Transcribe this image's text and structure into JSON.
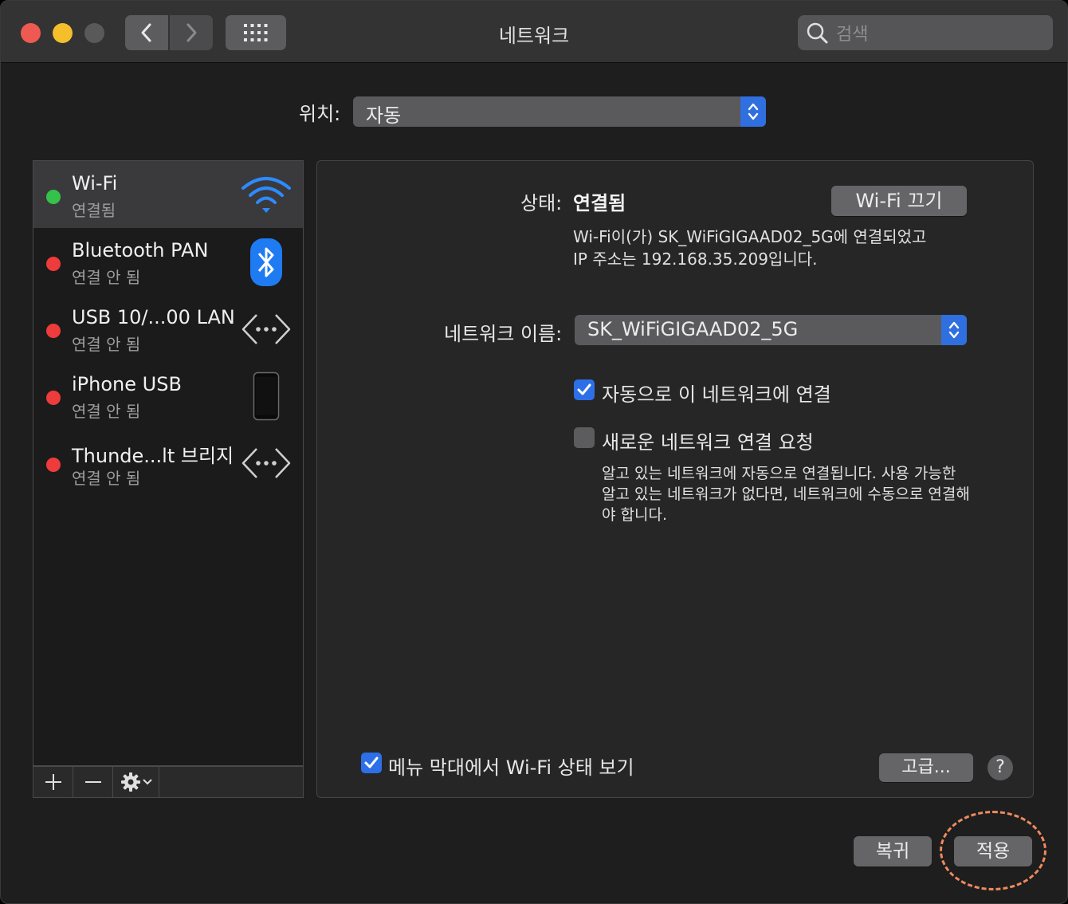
{
  "window": {
    "title": "네트워크"
  },
  "toolbar": {
    "search_placeholder": "검색"
  },
  "location": {
    "label": "위치:",
    "value": "자동"
  },
  "services": [
    {
      "name": "Wi-Fi",
      "status": "연결됨",
      "status_color": "#34c24a",
      "icon": "wifi-icon",
      "selected": true
    },
    {
      "name": "Bluetooth PAN",
      "status": "연결 안 됨",
      "status_color": "#ee3b3b",
      "icon": "bluetooth-icon"
    },
    {
      "name": "USB 10/...00 LAN",
      "status": "연결 안 됨",
      "status_color": "#ee3b3b",
      "icon": "ethernet-icon"
    },
    {
      "name": "iPhone USB",
      "status": "연결 안 됨",
      "status_color": "#ee3b3b",
      "icon": "iphone-icon"
    },
    {
      "name": "Thunde...lt 브리지",
      "status": "연결 안 됨",
      "status_color": "#ee3b3b",
      "icon": "ethernet-icon"
    }
  ],
  "detail": {
    "status_label": "상태:",
    "status_value": "연결됨",
    "wifi_off_button": "Wi-Fi 끄기",
    "status_desc_1": "Wi-Fi이(가) SK_WiFiGIGAAD02_5G에 연결되었고",
    "status_desc_2": "IP 주소는 192.168.35.209입니다.",
    "network_name_label": "네트워크 이름:",
    "network_name_value": "SK_WiFiGIGAAD02_5G",
    "auto_join_label": "자동으로 이 네트워크에 연결",
    "auto_join_checked": true,
    "ask_join_label": "새로운 네트워크 연결 요청",
    "ask_join_checked": false,
    "ask_desc_1": "알고 있는 네트워크에 자동으로 연결됩니다. 사용 가능한",
    "ask_desc_2": "알고 있는 네트워크가 없다면, 네트워크에 수동으로 연결해",
    "ask_desc_3": "야 합니다.",
    "menu_bar_label": "메뉴 막대에서 Wi-Fi 상태 보기",
    "menu_bar_checked": true,
    "advanced_button": "고급...",
    "help": "?"
  },
  "footer": {
    "revert_button": "복귀",
    "apply_button": "적용"
  },
  "colors": {
    "accent": "#2f6fe0",
    "highlight": "#f08a5d"
  }
}
